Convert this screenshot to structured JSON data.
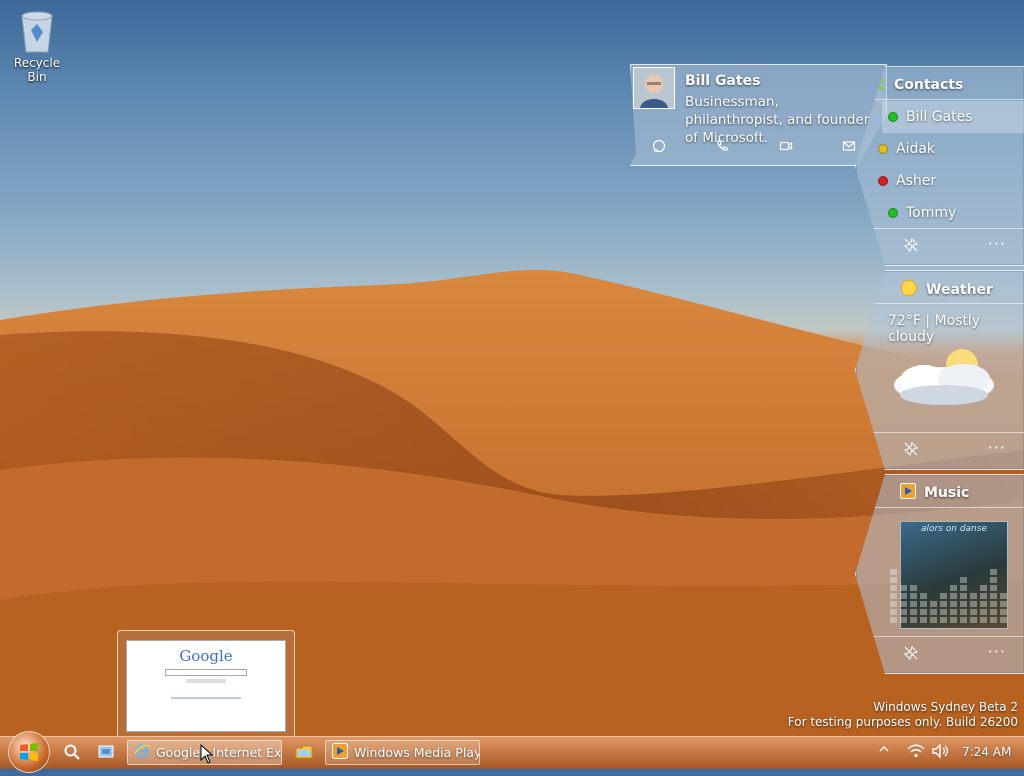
{
  "desktop": {
    "recycle_bin_label": "Recycle Bin"
  },
  "contact_card": {
    "name": "Bill Gates",
    "description": "Businessman, philanthropist, and founder of Microsoft.",
    "actions": [
      "message",
      "call",
      "video",
      "mail"
    ]
  },
  "contacts": {
    "title": "Contacts",
    "items": [
      {
        "name": "Bill Gates",
        "status_color": "#22c022"
      },
      {
        "name": "Aidak",
        "status_color": "#e0c020"
      },
      {
        "name": "Asher",
        "status_color": "#d02020"
      },
      {
        "name": "Tommy",
        "status_color": "#22c022"
      }
    ]
  },
  "weather": {
    "title": "Weather",
    "summary": "72°F | Mostly cloudy"
  },
  "music": {
    "title": "Music",
    "album_text": "alors on danse"
  },
  "build_info": {
    "line1": "Windows Sydney Beta 2",
    "line2": "For testing purposes only. Build 26200"
  },
  "taskbar": {
    "buttons": [
      {
        "label": "Google - Internet Ex..."
      },
      {
        "label": "Windows Media Play..."
      }
    ],
    "clock": "7:24 AM",
    "preview": {
      "logo_text": "Google"
    }
  }
}
